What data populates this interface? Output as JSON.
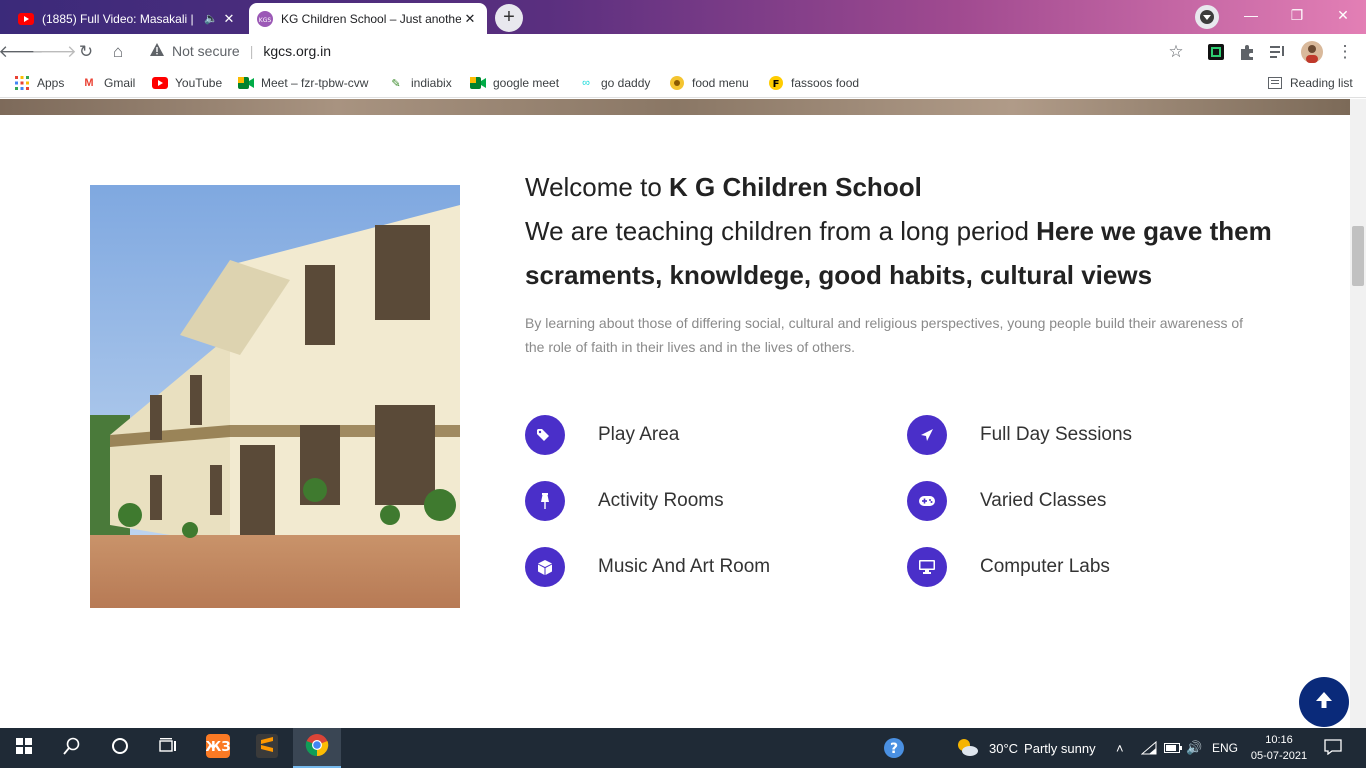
{
  "browser": {
    "tabs": [
      {
        "title": "(1885) Full Video: Masakali | ",
        "audio_icon": "speaker-icon",
        "close": "✕"
      },
      {
        "title": "KG Children School – Just anothe",
        "close": "✕"
      }
    ],
    "new_tab": "+",
    "window_controls": {
      "minimize": "—",
      "restore": "❐",
      "close": "✕"
    },
    "address": {
      "security": "Not secure",
      "url": "kgcs.org.in"
    },
    "bookmarks": [
      {
        "label": "Apps",
        "icon": "apps-grid-icon"
      },
      {
        "label": "Gmail",
        "icon": "gmail-icon"
      },
      {
        "label": "YouTube",
        "icon": "youtube-icon"
      },
      {
        "label": "Meet – fzr-tpbw-cvw",
        "icon": "meet-icon"
      },
      {
        "label": "indiabix",
        "icon": "indiabix-icon"
      },
      {
        "label": "google meet",
        "icon": "meet-icon"
      },
      {
        "label": "go daddy",
        "icon": "godaddy-icon"
      },
      {
        "label": "food menu",
        "icon": "food-icon"
      },
      {
        "label": "fassoos food",
        "icon": "fassos-icon"
      }
    ],
    "reading_list": "Reading list"
  },
  "page": {
    "welcome_prefix": "Welcome to ",
    "school_name": "K G Children School",
    "tagline_prefix": "We are teaching children from a long period ",
    "tagline_bold": "Here we gave them scraments, knowldege, good habits, cultural views",
    "description": "By learning about those of differing social, cultural and religious perspectives, young people build their awareness of the role of faith in their lives and in the lives of others.",
    "features": [
      {
        "label": "Play Area",
        "icon": "tags-icon"
      },
      {
        "label": "Full Day Sessions",
        "icon": "plane-icon"
      },
      {
        "label": "Activity Rooms",
        "icon": "pin-icon"
      },
      {
        "label": "Varied Classes",
        "icon": "gamepad-icon"
      },
      {
        "label": "Music And Art Room",
        "icon": "cube-icon"
      },
      {
        "label": "Computer Labs",
        "icon": "desktop-icon"
      }
    ],
    "colors": {
      "accent": "#4a2fc9",
      "back_to_top": "#0a2a7a"
    }
  },
  "taskbar": {
    "weather": {
      "temp": "30°C",
      "condition": "Partly sunny"
    },
    "language": "ENG",
    "time": "10:16",
    "date": "05-07-2021"
  }
}
